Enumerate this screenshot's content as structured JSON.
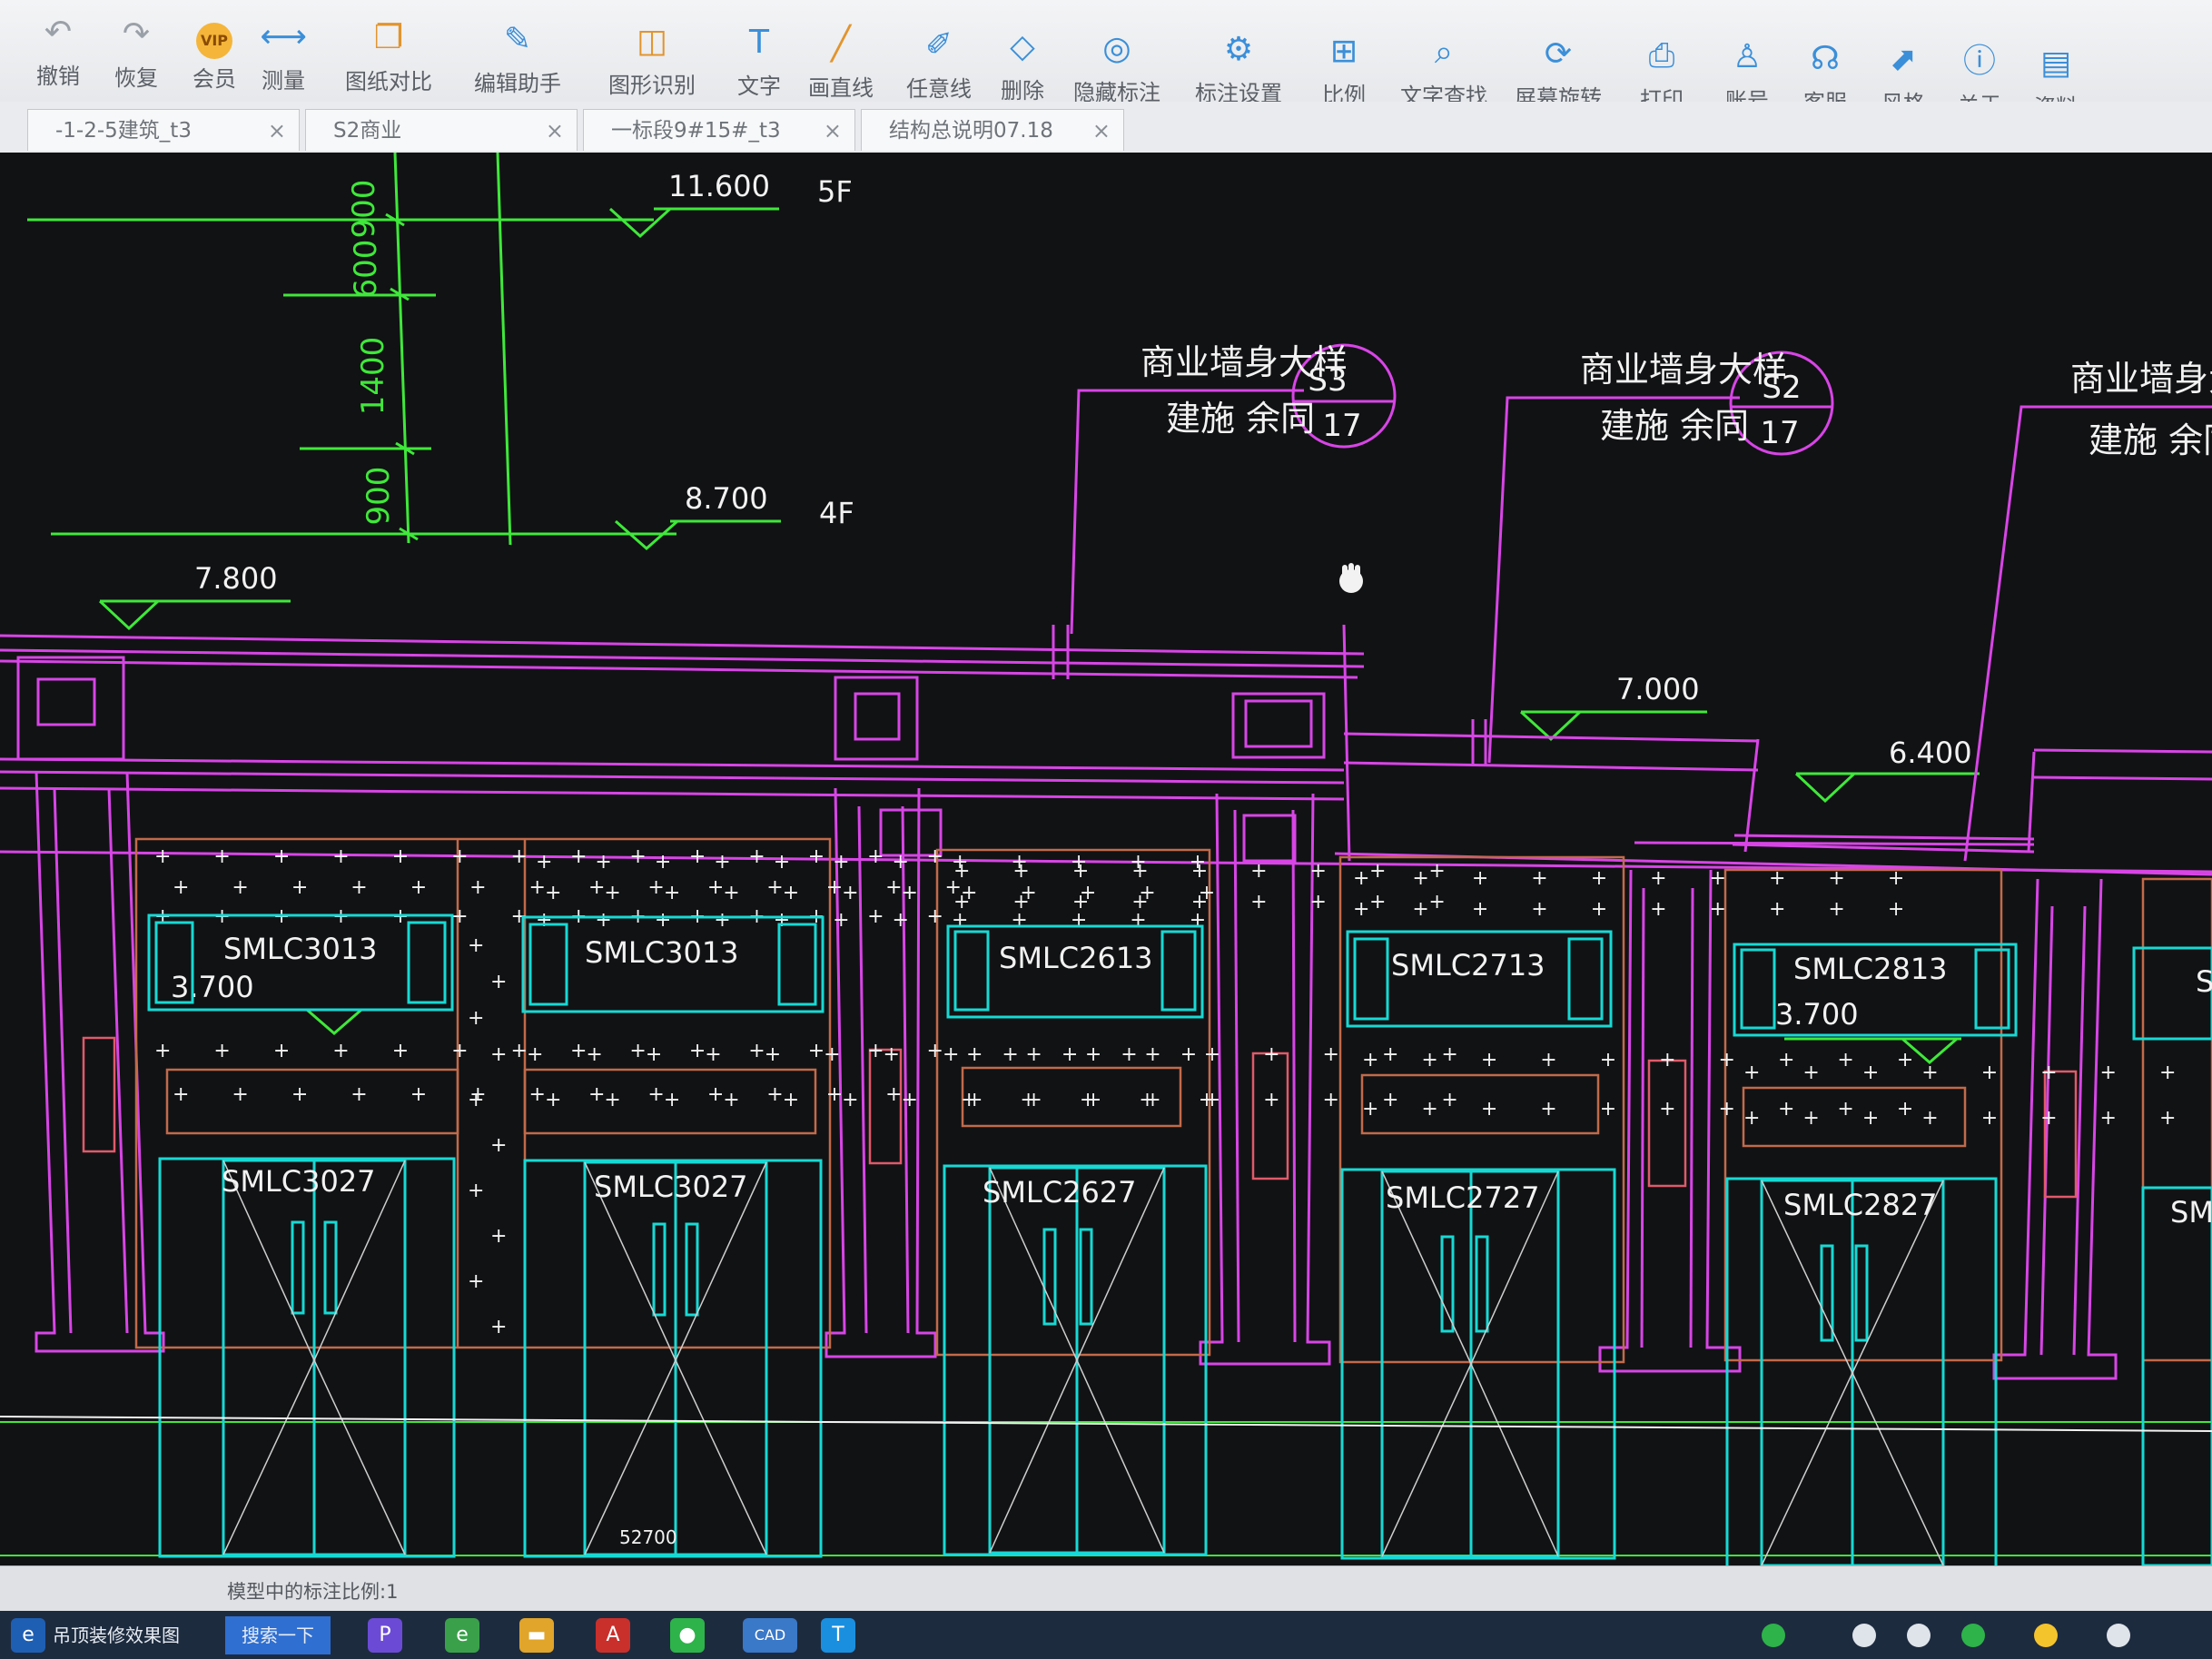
{
  "toolbar": {
    "items": [
      {
        "label": "撤销",
        "icon": "undo-icon"
      },
      {
        "label": "恢复",
        "icon": "redo-icon"
      },
      {
        "label": "会员",
        "icon": "vip-icon",
        "badge": "VIP"
      },
      {
        "label": "测量",
        "icon": "measure-icon"
      },
      {
        "label": "图纸对比",
        "icon": "compare-icon"
      },
      {
        "label": "编辑助手",
        "icon": "edit-assistant-icon"
      },
      {
        "label": "图形识别",
        "icon": "shape-recognize-icon"
      },
      {
        "label": "文字",
        "icon": "text-icon"
      },
      {
        "label": "画直线",
        "icon": "line-icon"
      },
      {
        "label": "任意线",
        "icon": "freehand-icon"
      },
      {
        "label": "删除",
        "icon": "eraser-icon"
      },
      {
        "label": "隐藏标注",
        "icon": "hide-annotation-icon"
      },
      {
        "label": "标注设置",
        "icon": "annotation-settings-icon"
      },
      {
        "label": "比例",
        "icon": "scale-icon"
      },
      {
        "label": "文字查找",
        "icon": "text-search-icon"
      },
      {
        "label": "屏幕旋转",
        "icon": "rotate-screen-icon"
      },
      {
        "label": "打印",
        "icon": "print-icon"
      },
      {
        "label": "账号",
        "icon": "account-icon"
      },
      {
        "label": "客服",
        "icon": "support-icon"
      },
      {
        "label": "风格",
        "icon": "style-icon"
      },
      {
        "label": "关于",
        "icon": "info-icon"
      },
      {
        "label": "资料",
        "icon": "resources-icon"
      }
    ]
  },
  "tabs": [
    {
      "title": "-1-2-5建筑_t3",
      "close": "×"
    },
    {
      "title": "S2商业",
      "close": "×"
    },
    {
      "title": "一标段9#15#_t3",
      "close": "×"
    },
    {
      "title": "结构总说明07.18",
      "close": "×"
    }
  ],
  "drawing": {
    "dims": [
      "900",
      "600",
      "1400",
      "900"
    ],
    "levels": [
      {
        "value": "11.600",
        "floor": "5F"
      },
      {
        "value": "8.700",
        "floor": "4F"
      },
      {
        "value": "7.800"
      },
      {
        "value": "7.000"
      },
      {
        "value": "6.400"
      },
      {
        "value": "3.700"
      },
      {
        "value": "3.700"
      }
    ],
    "details": [
      {
        "title": "商业墙身大样",
        "sub": "建施 余同",
        "code": "S3",
        "sheet": "17"
      },
      {
        "title": "商业墙身大样",
        "sub": "建施 余同",
        "code": "S2",
        "sheet": "17"
      },
      {
        "title": "商业墙身大",
        "sub": "建施 余同"
      }
    ],
    "windows": [
      "SMLC3013",
      "SMLC3013",
      "SMLC2613",
      "SMLC2713",
      "SMLC2813",
      "S"
    ],
    "doors": [
      "SMLC3027",
      "SMLC3027",
      "SMLC2627",
      "SMLC2727",
      "SMLC2827",
      "SML"
    ],
    "total_dim": "52700",
    "colors": {
      "green": "#3fe83a",
      "magenta": "#d845e6",
      "cyan": "#17d9d4",
      "white": "#f2f2f2",
      "brown": "#c26a4a",
      "background": "#111214"
    }
  },
  "status": {
    "text": "模型中的标注比例:1"
  },
  "taskbar": {
    "search_label": "吊顶装修效果图",
    "search_button": "搜索一下",
    "active_app": "CAD"
  }
}
